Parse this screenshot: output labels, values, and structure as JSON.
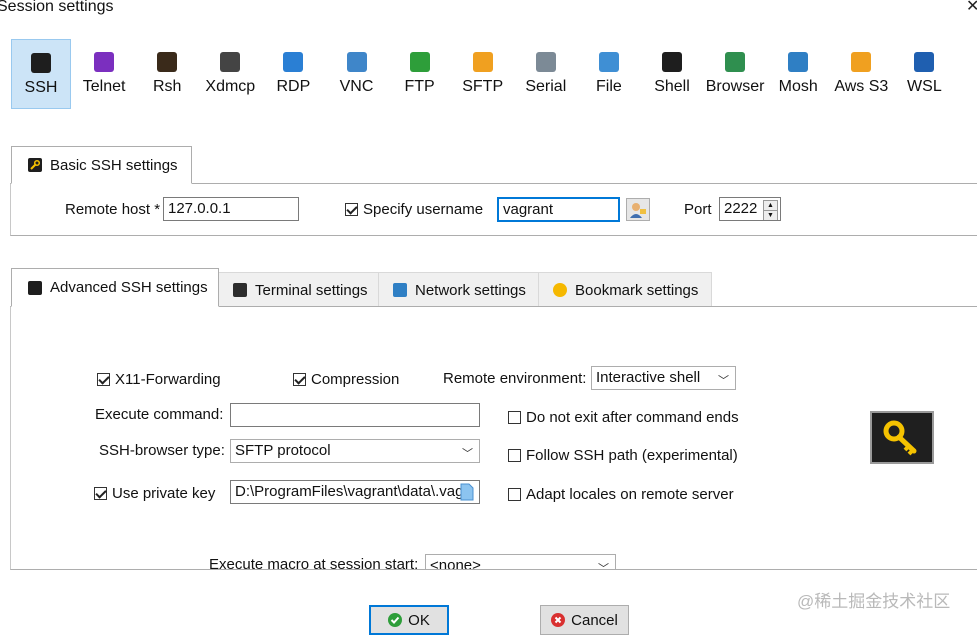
{
  "window": {
    "title": "Session settings",
    "close_symbol": "✕"
  },
  "protocols": [
    {
      "label": "SSH",
      "icon": "ssh-icon",
      "selected": true,
      "color": "#1e1e1e"
    },
    {
      "label": "Telnet",
      "icon": "telnet-icon",
      "color": "#7b2fbf"
    },
    {
      "label": "Rsh",
      "icon": "rsh-icon",
      "color": "#3a2a1a"
    },
    {
      "label": "Xdmcp",
      "icon": "xdmcp-icon",
      "color": "#444444"
    },
    {
      "label": "RDP",
      "icon": "rdp-icon",
      "color": "#2a7fd4"
    },
    {
      "label": "VNC",
      "icon": "vnc-icon",
      "color": "#3f86c9"
    },
    {
      "label": "FTP",
      "icon": "ftp-icon",
      "color": "#2e9e3a"
    },
    {
      "label": "SFTP",
      "icon": "sftp-icon",
      "color": "#f0a020"
    },
    {
      "label": "Serial",
      "icon": "serial-icon",
      "color": "#7c8a96"
    },
    {
      "label": "File",
      "icon": "file-icon",
      "color": "#3f8fd4"
    },
    {
      "label": "Shell",
      "icon": "shell-icon",
      "color": "#1e1e1e"
    },
    {
      "label": "Browser",
      "icon": "browser-icon",
      "color": "#2f8f4f"
    },
    {
      "label": "Mosh",
      "icon": "mosh-icon",
      "color": "#2f7fc4"
    },
    {
      "label": "Aws S3",
      "icon": "aws-s3-icon",
      "color": "#f0a020"
    },
    {
      "label": "WSL",
      "icon": "wsl-icon",
      "color": "#1f5fb0"
    }
  ],
  "basic": {
    "tab_label": "Basic SSH settings",
    "remote_host_label": "Remote host *",
    "remote_host_value": "127.0.0.1",
    "specify_username_label": "Specify username",
    "specify_username_checked": true,
    "username_value": "vagrant",
    "port_label": "Port",
    "port_value": "2222"
  },
  "tabs": [
    {
      "label": "Advanced SSH settings",
      "icon": "wrench-icon",
      "active": true
    },
    {
      "label": "Terminal settings",
      "icon": "terminal-icon"
    },
    {
      "label": "Network settings",
      "icon": "network-icon"
    },
    {
      "label": "Bookmark settings",
      "icon": "star-icon"
    }
  ],
  "advanced": {
    "x11_label": "X11-Forwarding",
    "compression_label": "Compression",
    "remote_env_label": "Remote environment:",
    "remote_env_value": "Interactive shell",
    "execute_command_label": "Execute command:",
    "execute_command_value": "",
    "do_not_exit_label": "Do not exit after command ends",
    "ssh_browser_label": "SSH-browser type:",
    "ssh_browser_value": "SFTP protocol",
    "follow_ssh_label": "Follow SSH path (experimental)",
    "use_private_key_label": "Use private key",
    "private_key_value": "D:\\ProgramFiles\\vagrant\\data\\.vag",
    "adapt_locales_label": "Adapt locales on remote server",
    "macro_label": "Execute macro at session start:",
    "macro_value": "<none>"
  },
  "buttons": {
    "ok": "OK",
    "cancel": "Cancel"
  },
  "watermark": "@稀土掘金技术社区",
  "colors": {
    "selected_bg": "#cce4f7",
    "focus_border": "#0078d7",
    "key_icon_bg": "#1f1f1f",
    "key_icon_fg": "#f5c200"
  }
}
